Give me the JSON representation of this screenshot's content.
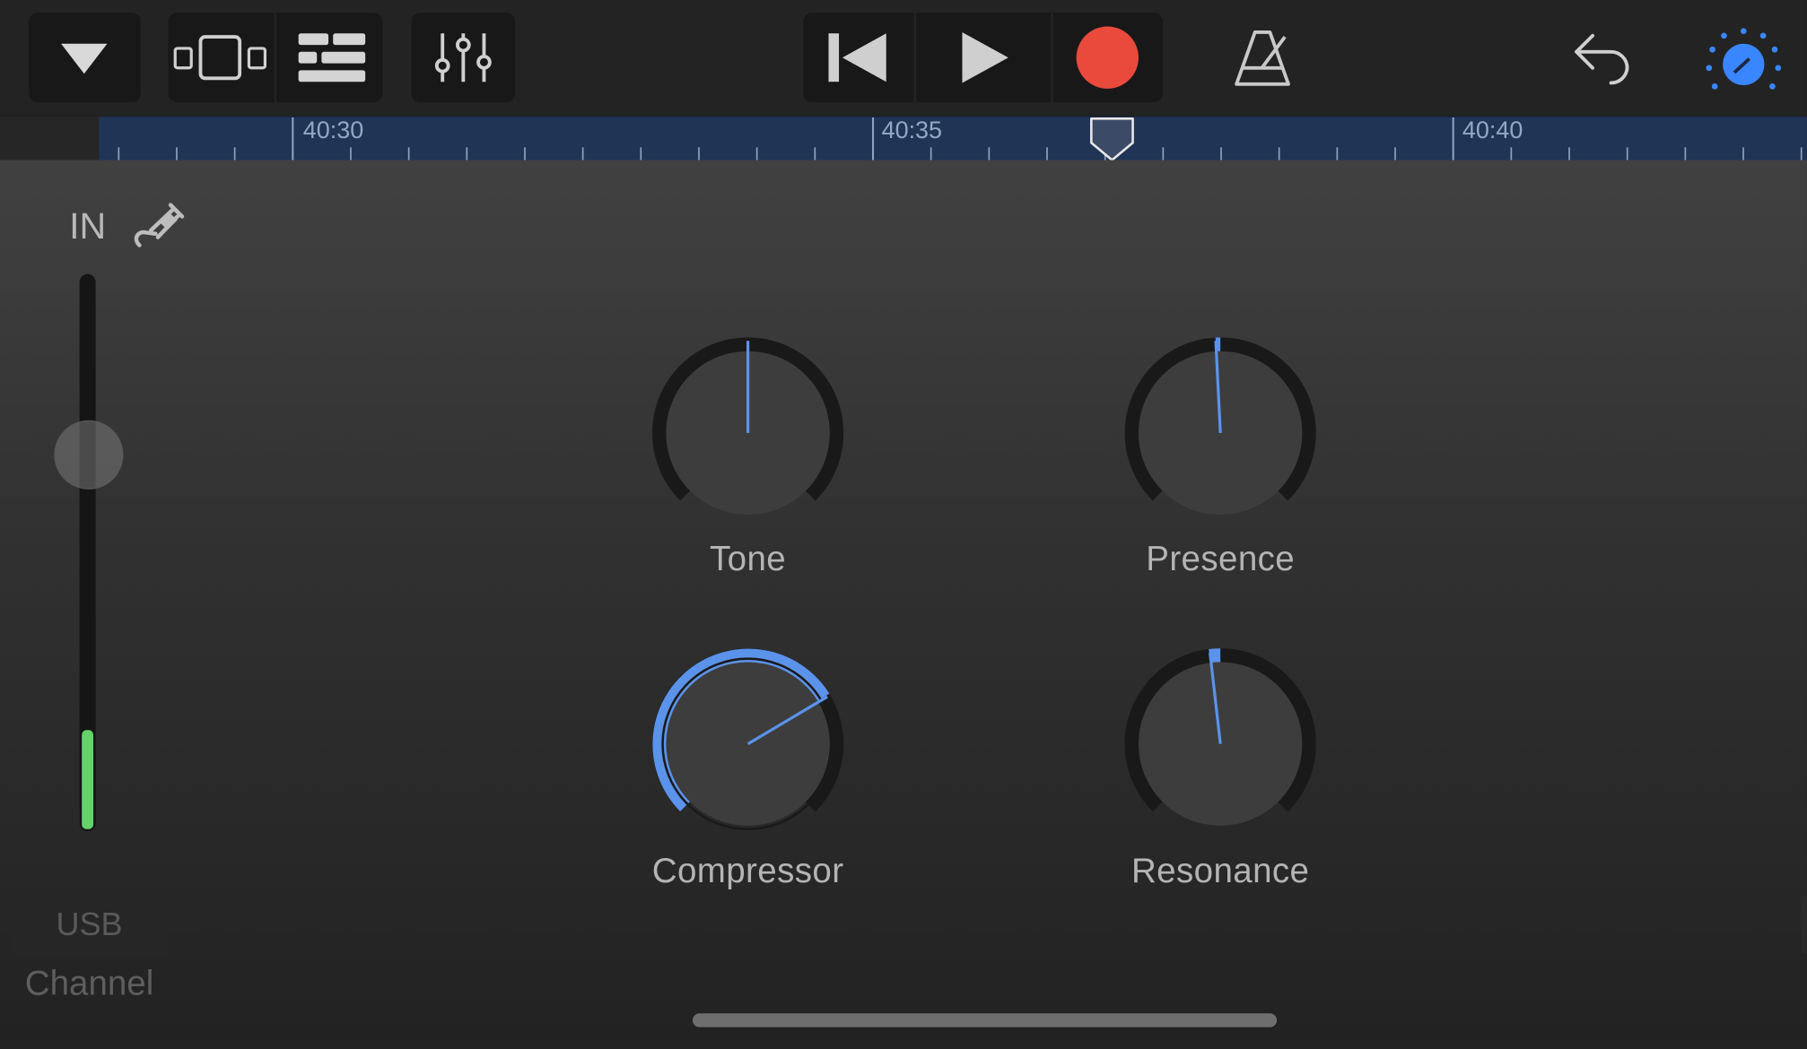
{
  "toolbar": {
    "buttons": [
      {
        "name": "browser-dropdown",
        "icon": "triangle-down-icon"
      },
      {
        "name": "tracks-view",
        "icon": "tracks-view-icon"
      },
      {
        "name": "arrangement-view",
        "icon": "grid-view-icon"
      },
      {
        "name": "mixer",
        "icon": "sliders-icon"
      },
      {
        "name": "go-to-beginning",
        "icon": "skip-back-icon"
      },
      {
        "name": "play",
        "icon": "play-icon"
      },
      {
        "name": "record",
        "icon": "record-icon"
      },
      {
        "name": "metronome",
        "icon": "metronome-icon"
      },
      {
        "name": "undo",
        "icon": "undo-icon"
      },
      {
        "name": "smart-controls",
        "icon": "knob-icon"
      }
    ],
    "record_color": "#e94a3c",
    "accent_color": "#3a86ff"
  },
  "ruler": {
    "markers": [
      "40:30",
      "40:35",
      "40:40"
    ]
  },
  "input": {
    "label": "IN",
    "icon": "guitar-cable-icon",
    "level_color": "#63d26a"
  },
  "knobs": [
    {
      "label": "Tone",
      "active": false
    },
    {
      "label": "Presence",
      "active": false
    },
    {
      "label": "Compressor",
      "active": true
    },
    {
      "label": "Resonance",
      "active": false
    }
  ],
  "footer": {
    "usb_label": "USB",
    "channel_label": "Channel"
  }
}
